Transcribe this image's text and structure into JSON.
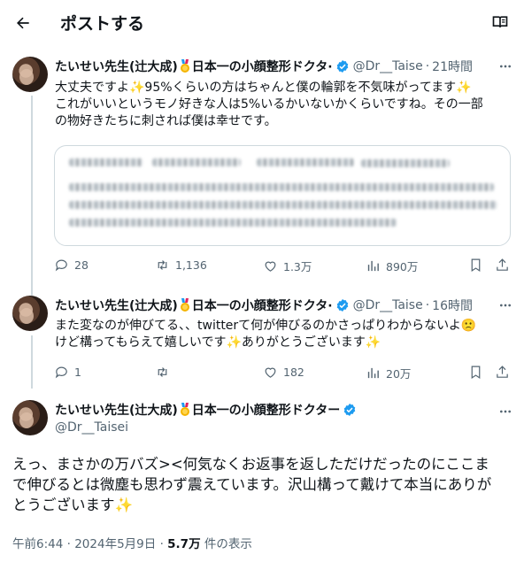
{
  "header": {
    "title": "ポストする",
    "back_icon": "arrow-left-icon",
    "reader_icon": "book-open-icon"
  },
  "accent": "#1d9bf0",
  "tweets": [
    {
      "display_name": "たいせい先生(辻大成)",
      "name_suffix": "日本一の小顔整形ドクタ·",
      "handle": "@Dr__Taise",
      "time": "21時間",
      "lines": [
        "大丈夫ですよ✨95%くらいの方はちゃんと僕の輪郭を不気味がってます✨",
        "これがいいというモノ好きな人は5%いるかいないかくらいですね。その一部",
        "の物好きたちに刺されば僕は幸せです。"
      ],
      "replies": "28",
      "reposts": "1,136",
      "likes": "1.3万",
      "views": "890万"
    },
    {
      "display_name": "たいせい先生(辻大成)",
      "name_suffix": "日本一の小顔整形ドクタ·",
      "handle": "@Dr__Taise",
      "time": "16時間",
      "lines": [
        "また変なのが伸びてる、、twitterて何が伸びるのかさっぱりわからないよ🙁",
        "けど構ってもらえて嬉しいです✨ありがとうございます✨"
      ],
      "replies": "1",
      "reposts": "",
      "likes": "182",
      "views": "20万"
    }
  ],
  "main_post": {
    "display_name": "たいせい先生(辻大成)",
    "name_suffix": "日本一の小顔整形ドクター",
    "handle": "@Dr__Taisei",
    "lines": [
      "えっ、まさかの万バズ><何気なくお返事を返しただけだったのにここま",
      "で伸びるとは微塵も思わず震えています。沢山構って戴けて本当にありが",
      "とうございます✨"
    ],
    "time": "午前6:44",
    "date": "2024年5月9日",
    "views_count": "5.7万",
    "views_label": "件の表示"
  }
}
